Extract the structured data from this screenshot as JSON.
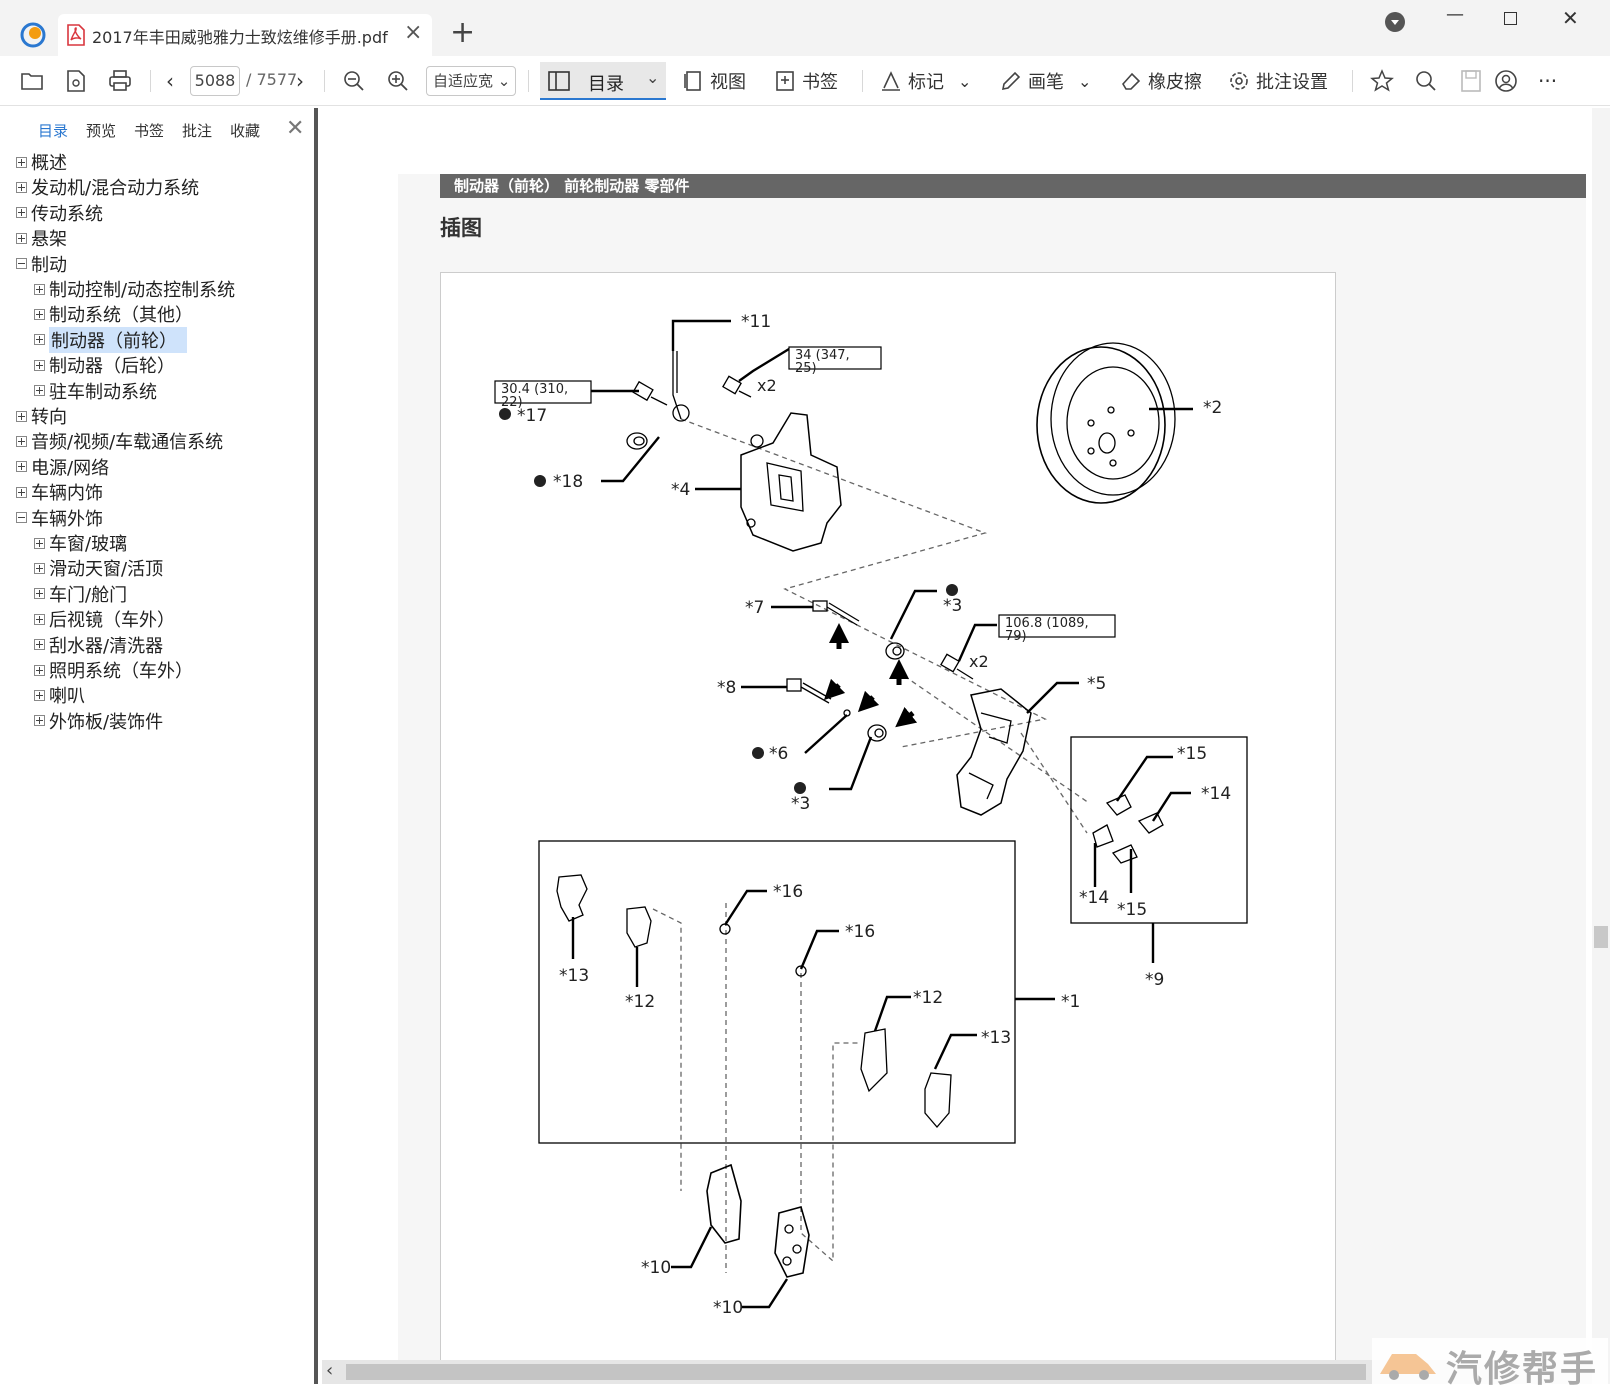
{
  "tab": {
    "title": "2017年丰田威驰雅力士致炫维修手册.pdf",
    "close": "×",
    "new": "+"
  },
  "window": {
    "minimize": "—",
    "close": "✕"
  },
  "toolbar": {
    "page_current": "5088",
    "page_total": "/ 7577",
    "zoom": "自适应宽",
    "toc": "目录",
    "view": "视图",
    "bookmark": "书签",
    "mark": "标记",
    "pen": "画笔",
    "eraser": "橡皮擦",
    "annot_settings": "批注设置",
    "more": "···"
  },
  "sidebar": {
    "tabs": [
      "目录",
      "预览",
      "书签",
      "批注",
      "收藏"
    ],
    "close": "✕",
    "items": [
      {
        "label": "概述",
        "level": 0,
        "state": "plus"
      },
      {
        "label": "发动机/混合动力系统",
        "level": 0,
        "state": "plus"
      },
      {
        "label": "传动系统",
        "level": 0,
        "state": "plus"
      },
      {
        "label": "悬架",
        "level": 0,
        "state": "plus"
      },
      {
        "label": "制动",
        "level": 0,
        "state": "minus"
      },
      {
        "label": "制动控制/动态控制系统",
        "level": 1,
        "state": "plus"
      },
      {
        "label": "制动系统（其他）",
        "level": 1,
        "state": "plus"
      },
      {
        "label": "制动器（前轮）",
        "level": 1,
        "state": "plus",
        "selected": true
      },
      {
        "label": "制动器（后轮）",
        "level": 1,
        "state": "plus"
      },
      {
        "label": "驻车制动系统",
        "level": 1,
        "state": "plus"
      },
      {
        "label": "转向",
        "level": 0,
        "state": "plus"
      },
      {
        "label": "音频/视频/车载通信系统",
        "level": 0,
        "state": "plus"
      },
      {
        "label": "电源/网络",
        "level": 0,
        "state": "plus"
      },
      {
        "label": "车辆内饰",
        "level": 0,
        "state": "plus"
      },
      {
        "label": "车辆外饰",
        "level": 0,
        "state": "minus"
      },
      {
        "label": "车窗/玻璃",
        "level": 1,
        "state": "plus"
      },
      {
        "label": "滑动天窗/活顶",
        "level": 1,
        "state": "plus"
      },
      {
        "label": "车门/舱门",
        "level": 1,
        "state": "plus"
      },
      {
        "label": "后视镜（车外）",
        "level": 1,
        "state": "plus"
      },
      {
        "label": "刮水器/清洗器",
        "level": 1,
        "state": "plus"
      },
      {
        "label": "照明系统（车外）",
        "level": 1,
        "state": "plus"
      },
      {
        "label": "喇叭",
        "level": 1,
        "state": "plus"
      },
      {
        "label": "外饰板/装饰件",
        "level": 1,
        "state": "plus"
      }
    ]
  },
  "document": {
    "header": "制动器（前轮）  前轮制动器  零部件",
    "section_title": "插图",
    "callouts": {
      "c11": "*11",
      "c2": "*2",
      "c17": "*17",
      "c18": "*18",
      "c4": "*4",
      "c7": "*7",
      "c3a": "*3",
      "c8": "*8",
      "c6": "*6",
      "c3b": "*3",
      "c5": "*5",
      "c15a": "*15",
      "c14a": "*14",
      "c14b": "*14",
      "c15b": "*15",
      "c9": "*9",
      "c16a": "*16",
      "c16b": "*16",
      "c13a": "*13",
      "c12a": "*12",
      "c12b": "*12",
      "c13b": "*13",
      "c1": "*1",
      "c10a": "*10",
      "c10b": "*10"
    },
    "torques": {
      "t1_line1": "34 (347,",
      "t1_line2": "25)",
      "t2_line1": "30.4 (310,",
      "t2_line2": "22)",
      "t3_line1": "106.8 (1089,",
      "t3_line2": "79)"
    },
    "qty": {
      "q1": "x2",
      "q2": "x2"
    }
  },
  "watermark": "汽修帮手",
  "icons": [
    "app-logo-icon",
    "pdf-file-icon",
    "folder-icon",
    "save-icon",
    "print-icon",
    "zoom-out-icon",
    "zoom-in-icon",
    "sidebar-panel-icon",
    "view-icon",
    "bookmark-icon",
    "highlight-icon",
    "pen-icon",
    "eraser-icon",
    "gear-icon",
    "star-icon",
    "search-icon",
    "user-icon"
  ]
}
